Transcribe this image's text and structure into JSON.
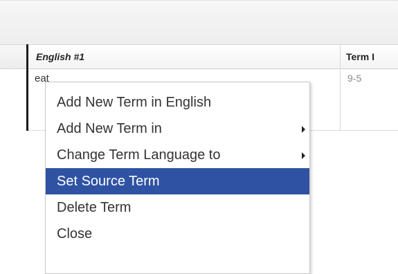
{
  "grid": {
    "columns": [
      {
        "label": "English #1"
      },
      {
        "label": "Term I"
      }
    ],
    "row": {
      "term": "eat",
      "term_id": "9-5"
    }
  },
  "context_menu": {
    "items": [
      {
        "label": "Add New Term in English",
        "has_submenu": false,
        "selected": false
      },
      {
        "label": "Add New Term in",
        "has_submenu": true,
        "selected": false
      },
      {
        "label": "Change Term Language to",
        "has_submenu": true,
        "selected": false
      },
      {
        "label": "Set Source Term",
        "has_submenu": false,
        "selected": true
      },
      {
        "label": "Delete Term",
        "has_submenu": false,
        "selected": false
      },
      {
        "label": "Close",
        "has_submenu": false,
        "selected": false
      }
    ],
    "colors": {
      "selected_background": "#2f52a3",
      "selected_text": "#ffffff",
      "text": "#333333"
    }
  }
}
